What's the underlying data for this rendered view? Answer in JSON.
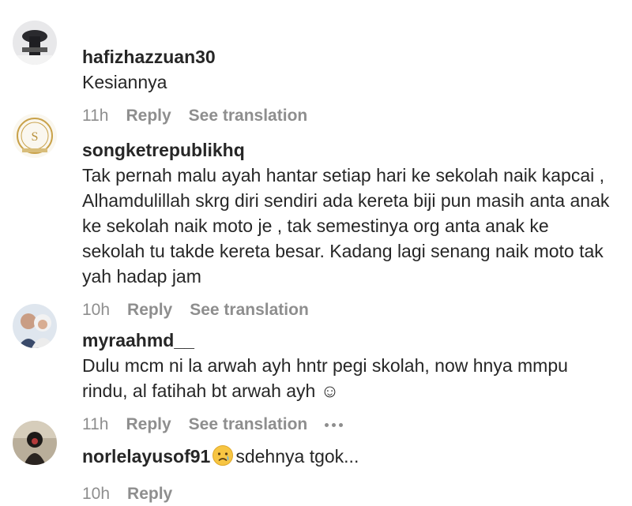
{
  "comments": [
    {
      "username": "hafizhazzuan30",
      "text": "Kesiannya",
      "time": "11h",
      "reply": "Reply",
      "translate": "See translation"
    },
    {
      "username": "songketrepublikhq",
      "text": "Tak pernah malu ayah hantar setiap hari ke sekolah naik kapcai , Alhamdulillah skrg diri sendiri ada kereta biji pun masih anta anak ke sekolah naik moto je , tak semestinya org anta anak ke sekolah tu takde kereta besar. Kadang lagi senang naik moto tak yah hadap jam",
      "time": "10h",
      "reply": "Reply",
      "translate": "See translation"
    },
    {
      "username": "myraahmd__",
      "text": "Dulu mcm ni la arwah ayh hntr pegi skolah, now hnya mmpu rindu, al fatihah bt arwah ayh ☺",
      "time": "11h",
      "reply": "Reply",
      "translate": "See translation",
      "more_icon": "more-horizontal-icon"
    },
    {
      "username": "norlelayusof91",
      "emoji": "crying-face-emoji",
      "text": "sdehnya tgok...",
      "time": "10h",
      "reply": "Reply"
    }
  ]
}
